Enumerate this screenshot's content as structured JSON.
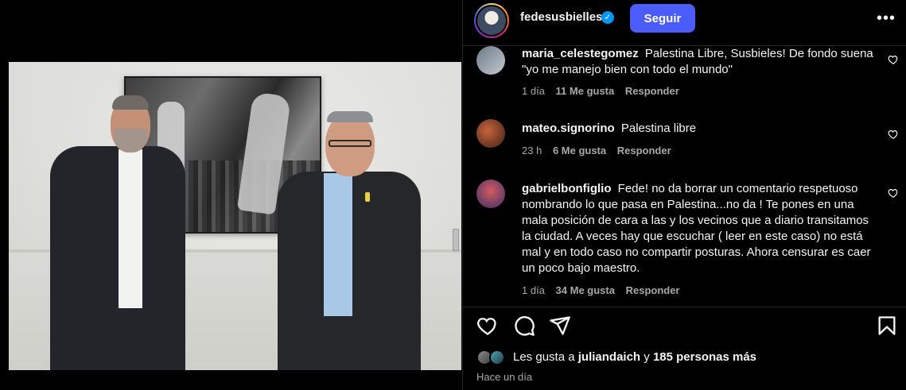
{
  "post": {
    "username": "fedesusbielles",
    "follow_label": "Seguir",
    "verified_mark": "✓",
    "more_glyph": "•••"
  },
  "comments": [
    {
      "username": "maria_celestegomez",
      "text": "Palestina Libre, Susbieles! De fondo suena \"yo me manejo bien con todo el mundo\"",
      "time": "1 día",
      "likes": "11 Me gusta",
      "reply": "Responder"
    },
    {
      "username": "mateo.signorino",
      "text": "Palestina libre",
      "time": "23 h",
      "likes": "6 Me gusta",
      "reply": "Responder"
    },
    {
      "username": "gabrielbonfiglio",
      "text": "Fede! no da borrar un comentario respetuoso nombrando lo que pasa en Palestina...no da ! Te pones en una mala posición de cara a las y los vecinos que a diario transitamos la ciudad. A veces hay que escuchar ( leer en este caso) no está mal y en todo caso no compartir posturas. Ahora censurar es caer un poco bajo maestro.",
      "time": "1 día",
      "likes": "34 Me gusta",
      "reply": "Responder"
    }
  ],
  "likes_summary": {
    "prefix": "Les gusta a",
    "user": "juliandaich",
    "connector": "y",
    "others": "185 personas más"
  },
  "posted_ago": "Hace un día",
  "icons": {
    "like": "heart-icon",
    "comment": "comment-bubble-icon",
    "share": "paper-plane-icon",
    "save": "bookmark-icon",
    "more": "more-options-icon",
    "verified": "verified-badge-icon"
  },
  "colors": {
    "background": "#000000",
    "follow_button": "#4a5df9",
    "verified": "#0095f6",
    "meta_text": "#a8a8a8"
  }
}
